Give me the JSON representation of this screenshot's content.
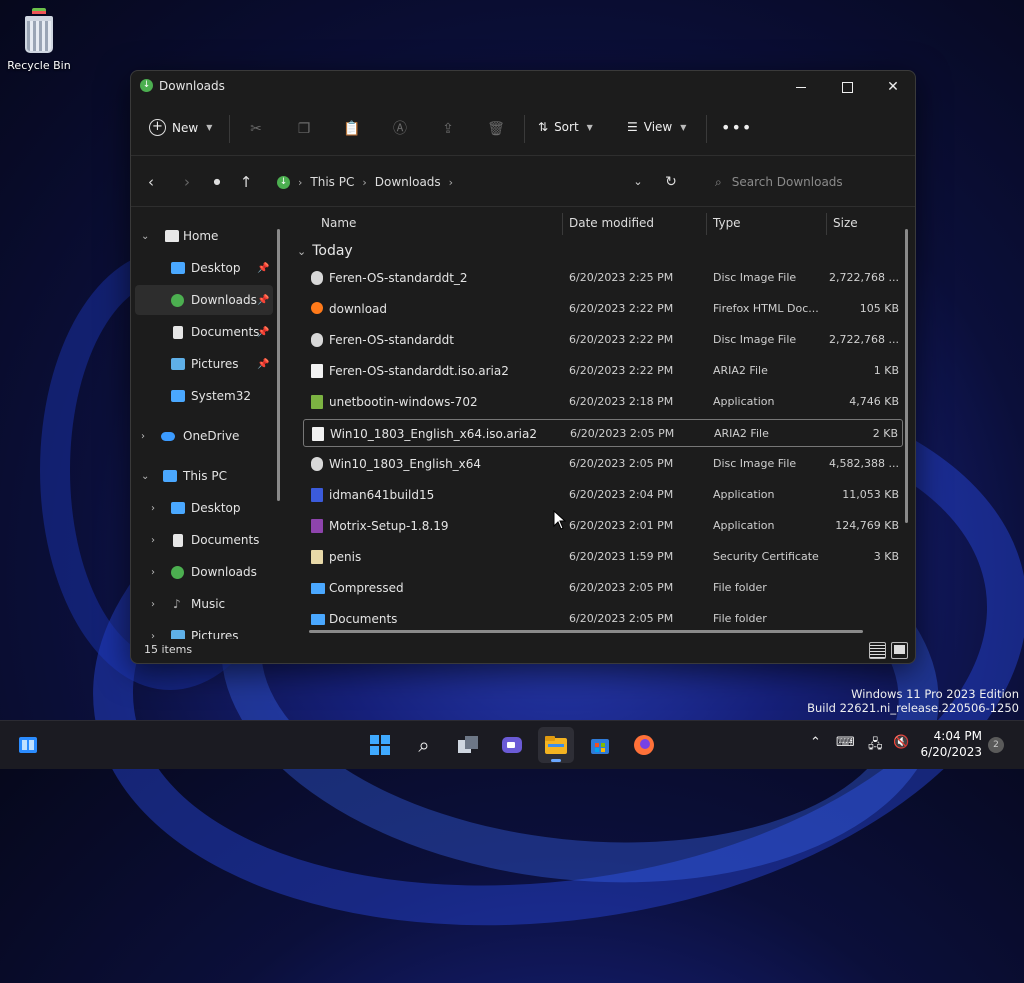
{
  "desktop": {
    "recycle_bin": "Recycle Bin"
  },
  "window": {
    "title": "Downloads",
    "toolbar": {
      "new": "New",
      "sort": "Sort",
      "view": "View",
      "more": "•••"
    },
    "breadcrumb": [
      "This PC",
      "Downloads"
    ],
    "search_placeholder": "Search Downloads"
  },
  "sidebar": {
    "items": [
      {
        "label": "Home"
      },
      {
        "label": "Desktop"
      },
      {
        "label": "Downloads"
      },
      {
        "label": "Documents"
      },
      {
        "label": "Pictures"
      },
      {
        "label": "System32"
      },
      {
        "label": "OneDrive"
      },
      {
        "label": "This PC"
      },
      {
        "label": "Desktop"
      },
      {
        "label": "Documents"
      },
      {
        "label": "Downloads"
      },
      {
        "label": "Music"
      },
      {
        "label": "Pictures"
      }
    ]
  },
  "columns": {
    "name": "Name",
    "date": "Date modified",
    "type": "Type",
    "size": "Size"
  },
  "group": "Today",
  "files": [
    {
      "name": "Feren-OS-standarddt_2",
      "date": "6/20/2023 2:25 PM",
      "type": "Disc Image File",
      "size": "2,722,768 ..."
    },
    {
      "name": "download",
      "date": "6/20/2023 2:22 PM",
      "type": "Firefox HTML Doc...",
      "size": "105 KB"
    },
    {
      "name": "Feren-OS-standarddt",
      "date": "6/20/2023 2:22 PM",
      "type": "Disc Image File",
      "size": "2,722,768 ..."
    },
    {
      "name": "Feren-OS-standarddt.iso.aria2",
      "date": "6/20/2023 2:22 PM",
      "type": "ARIA2 File",
      "size": "1 KB"
    },
    {
      "name": "unetbootin-windows-702",
      "date": "6/20/2023 2:18 PM",
      "type": "Application",
      "size": "4,746 KB"
    },
    {
      "name": "Win10_1803_English_x64.iso.aria2",
      "date": "6/20/2023 2:05 PM",
      "type": "ARIA2 File",
      "size": "2 KB"
    },
    {
      "name": "Win10_1803_English_x64",
      "date": "6/20/2023 2:05 PM",
      "type": "Disc Image File",
      "size": "4,582,388 ..."
    },
    {
      "name": "idman641build15",
      "date": "6/20/2023 2:04 PM",
      "type": "Application",
      "size": "11,053 KB"
    },
    {
      "name": "Motrix-Setup-1.8.19",
      "date": "6/20/2023 2:01 PM",
      "type": "Application",
      "size": "124,769 KB"
    },
    {
      "name": "penis",
      "date": "6/20/2023 1:59 PM",
      "type": "Security Certificate",
      "size": "3 KB"
    },
    {
      "name": "Compressed",
      "date": "6/20/2023 2:05 PM",
      "type": "File folder",
      "size": ""
    },
    {
      "name": "Documents",
      "date": "6/20/2023 2:05 PM",
      "type": "File folder",
      "size": ""
    }
  ],
  "status": "15 items",
  "watermark": {
    "line1": "Windows 11 Pro 2023 Edition",
    "line2": "Build 22621.ni_release.220506-1250"
  },
  "taskbar": {
    "time": "4:04 PM",
    "date": "6/20/2023",
    "notifications": "2"
  },
  "colors": {
    "folder": "#4aa8ff",
    "accent": "#6aa7ff",
    "home_green": "#4caf50"
  }
}
